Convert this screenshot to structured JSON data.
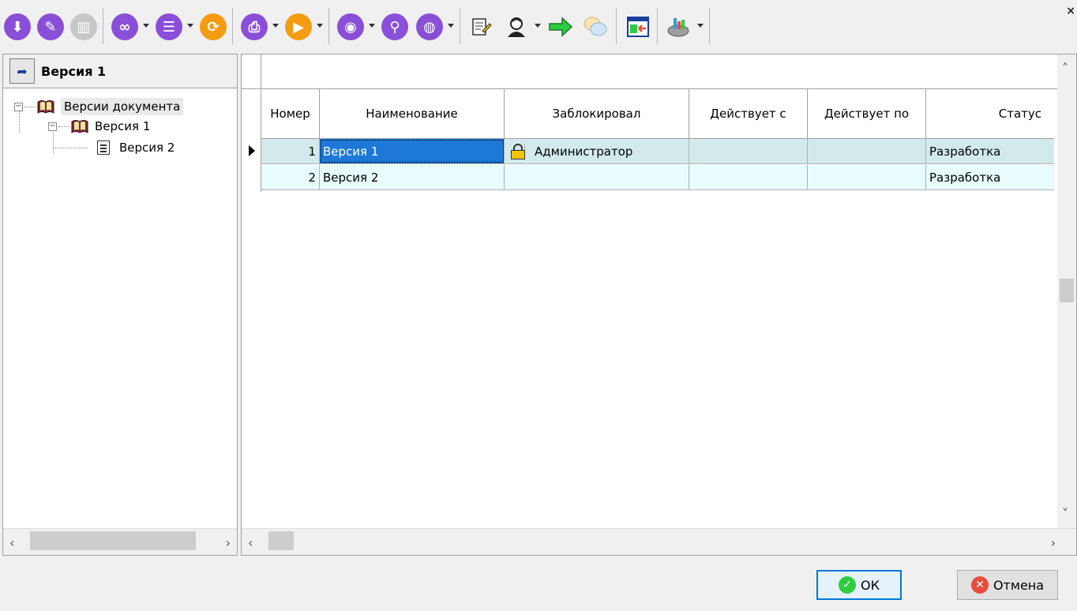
{
  "toolbar": {
    "icons": [
      {
        "name": "download-icon",
        "color": "#8a4fd8",
        "glyph": "⬇"
      },
      {
        "name": "edit-icon",
        "color": "#8a4fd8",
        "glyph": "✎"
      },
      {
        "name": "delete-icon",
        "color": "#c7c7c7",
        "glyph": "▥"
      },
      {
        "name": "link-icon",
        "color": "#8a4fd8",
        "glyph": "∞"
      },
      {
        "name": "list-icon",
        "color": "#8a4fd8",
        "glyph": "☰"
      },
      {
        "name": "refresh-icon",
        "color": "#f39c12",
        "glyph": "⟳"
      },
      {
        "name": "print-icon",
        "color": "#8a4fd8",
        "glyph": "⎙"
      },
      {
        "name": "play-icon",
        "color": "#f39c12",
        "glyph": "▶"
      },
      {
        "name": "view-icon",
        "color": "#8a4fd8",
        "glyph": "◉"
      },
      {
        "name": "zoom-icon",
        "color": "#8a4fd8",
        "glyph": "⚲"
      },
      {
        "name": "globe-icon",
        "color": "#8a4fd8",
        "glyph": "◍"
      }
    ],
    "close_glyph": "×"
  },
  "left_panel": {
    "title": "Версия 1",
    "back_glyph": "➦",
    "tree": {
      "root": {
        "label": "Версии документа",
        "expand": "−"
      },
      "child": {
        "label": "Версия 1",
        "expand": "−"
      },
      "leaf": {
        "label": "Версия 2"
      }
    },
    "scroll_left": "‹",
    "scroll_right": "›"
  },
  "grid": {
    "columns": [
      "Номер",
      "Наименование",
      "Заблокировал",
      "Действует с",
      "Действует по",
      "Статус"
    ],
    "rows": [
      {
        "number": "1",
        "name": "Версия 1",
        "locked_by": "Администратор",
        "valid_from": "",
        "valid_to": "",
        "status": "Разработка"
      },
      {
        "number": "2",
        "name": "Версия 2",
        "locked_by": "",
        "valid_from": "",
        "valid_to": "",
        "status": "Разработка"
      }
    ],
    "scroll_up": "˄",
    "scroll_down": "˅",
    "scroll_left": "‹",
    "scroll_right": "›"
  },
  "buttons": {
    "ok": "ОК",
    "cancel": "Отмена",
    "ok_color": "#2ecc40",
    "cancel_color": "#e74c3c"
  }
}
